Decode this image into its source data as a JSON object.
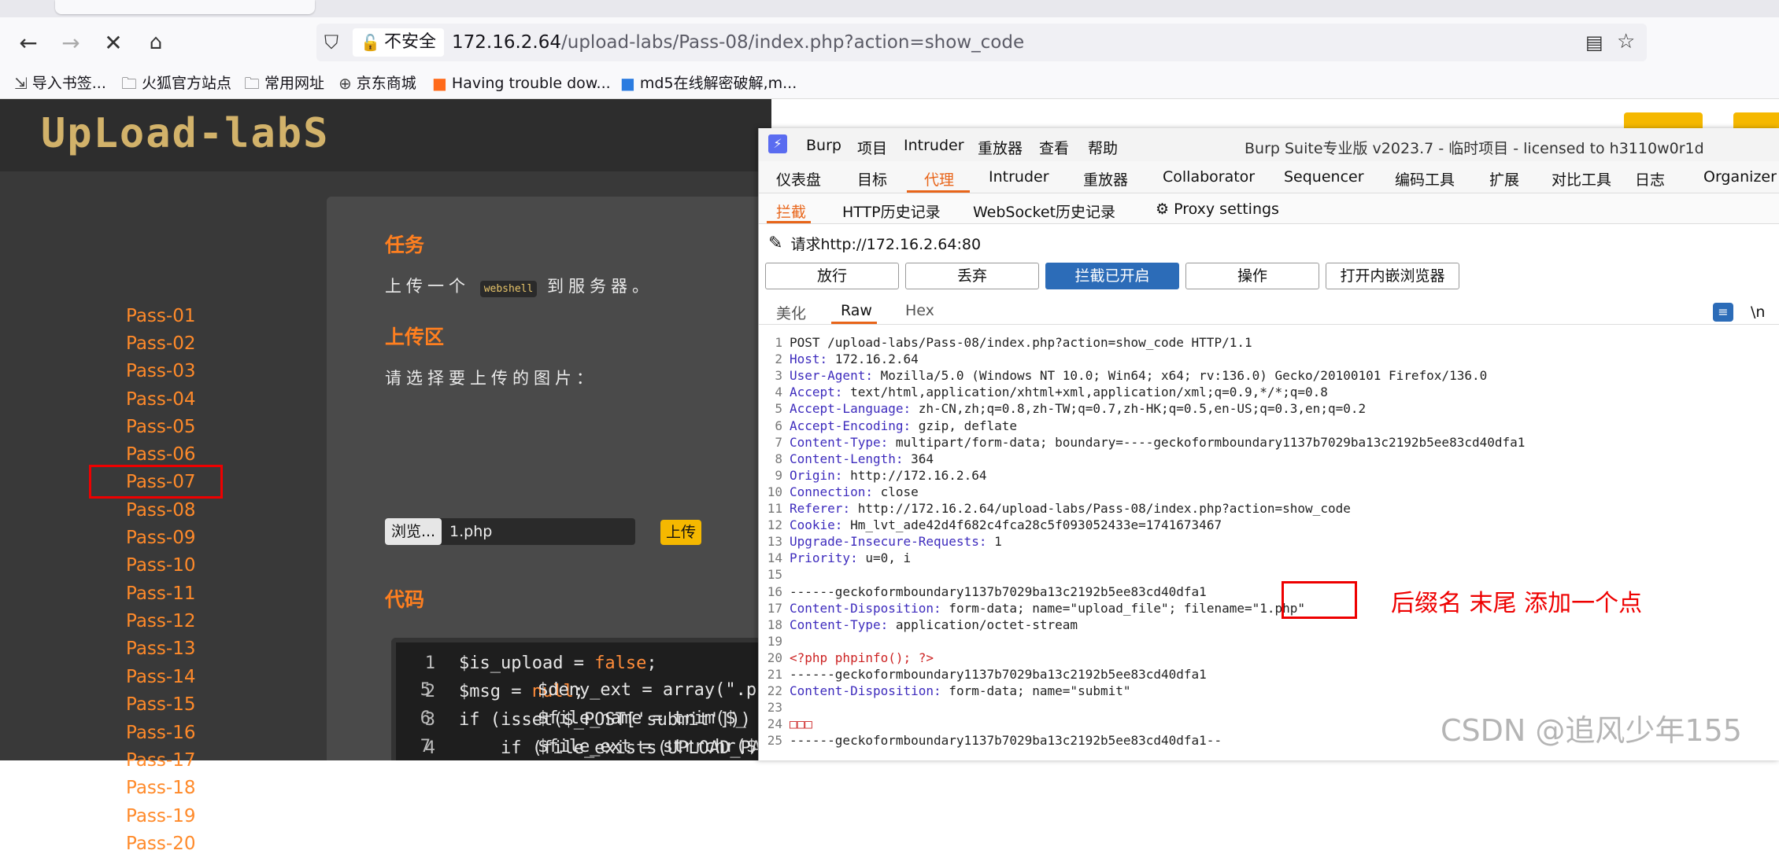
{
  "browser": {
    "insecure_label": "不安全",
    "url_host": "172.16.2.64",
    "url_path": "/upload-labs/Pass-08/index.php?action=show_code",
    "bookmarks": [
      {
        "label": "导入书签...",
        "icon": "import-icon"
      },
      {
        "label": "火狐官方站点",
        "icon": "folder-icon"
      },
      {
        "label": "常用网址",
        "icon": "folder-icon"
      },
      {
        "label": "京东商城",
        "icon": "globe-icon"
      },
      {
        "label": "Having trouble dow...",
        "icon": "bookmark-favicon"
      },
      {
        "label": "md5在线解密破解,m...",
        "icon": "bookmark-favicon"
      }
    ]
  },
  "labs": {
    "logo": "UpLoad-labS",
    "passes": [
      "Pass-01",
      "Pass-02",
      "Pass-03",
      "Pass-04",
      "Pass-05",
      "Pass-06",
      "Pass-07",
      "Pass-08",
      "Pass-09",
      "Pass-10",
      "Pass-11",
      "Pass-12",
      "Pass-13",
      "Pass-14",
      "Pass-15",
      "Pass-16",
      "Pass-17",
      "Pass-18",
      "Pass-19",
      "Pass-20"
    ],
    "task_title": "任务",
    "task_text_pre": "上传一个",
    "task_code": "webshell",
    "task_text_post": "到服务器。",
    "upload_title": "上传区",
    "upload_prompt": "请选择要上传的图片：",
    "browse_label": "浏览...",
    "file_name": "1.php",
    "upload_button": "上传",
    "code_title": "代码",
    "code_lines": [
      {
        "n": "1",
        "text": "$is_upload = false;"
      },
      {
        "n": "2",
        "text": "$msg = null;"
      },
      {
        "n": "3",
        "text": "if (isset($_POST['submit'])) {"
      },
      {
        "n": "4",
        "text": "    if (file_exists(UPLOAD_PA"
      },
      {
        "n": "5",
        "text": "        $deny_ext = array(\".p"
      },
      {
        "n": "6",
        "text": "        $file_name = trim($_"
      },
      {
        "n": "7",
        "text": "        $file_ext = strrchr($"
      }
    ]
  },
  "burp": {
    "menu": [
      "Burp",
      "项目",
      "Intruder",
      "重放器",
      "查看",
      "帮助"
    ],
    "title": "Burp Suite专业版  v2023.7 - 临时项目 - licensed to h3110w0r1d",
    "tabs": [
      "仪表盘",
      "目标",
      "代理",
      "Intruder",
      "重放器",
      "Collaborator",
      "Sequencer",
      "编码工具",
      "扩展",
      "对比工具",
      "日志",
      "Organizer"
    ],
    "subtabs": [
      "拦截",
      "HTTP历史记录",
      "WebSocket历史记录",
      "Proxy settings"
    ],
    "request_label": "请求http://172.16.2.64:80",
    "buttons": [
      "放行",
      "丢弃",
      "拦截已开启",
      "操作",
      "打开内嵌浏览器"
    ],
    "view_tabs": [
      "美化",
      "Raw",
      "Hex"
    ],
    "newline_toggle": "\\n",
    "request_lines": [
      {
        "n": "1",
        "k": "",
        "v": "POST /upload-labs/Pass-08/index.php?action=show_code HTTP/1.1"
      },
      {
        "n": "2",
        "k": "Host",
        "v": " 172.16.2.64"
      },
      {
        "n": "3",
        "k": "User-Agent",
        "v": " Mozilla/5.0 (Windows NT 10.0; Win64; x64; rv:136.0) Gecko/20100101 Firefox/136.0"
      },
      {
        "n": "4",
        "k": "Accept",
        "v": " text/html,application/xhtml+xml,application/xml;q=0.9,*/*;q=0.8"
      },
      {
        "n": "5",
        "k": "Accept-Language",
        "v": " zh-CN,zh;q=0.8,zh-TW;q=0.7,zh-HK;q=0.5,en-US;q=0.3,en;q=0.2"
      },
      {
        "n": "6",
        "k": "Accept-Encoding",
        "v": " gzip, deflate"
      },
      {
        "n": "7",
        "k": "Content-Type",
        "v": " multipart/form-data; boundary=----geckoformboundary1137b7029ba13c2192b5ee83cd40dfa1"
      },
      {
        "n": "8",
        "k": "Content-Length",
        "v": " 364"
      },
      {
        "n": "9",
        "k": "Origin",
        "v": " http://172.16.2.64"
      },
      {
        "n": "10",
        "k": "Connection",
        "v": " close"
      },
      {
        "n": "11",
        "k": "Referer",
        "v": " http://172.16.2.64/upload-labs/Pass-08/index.php?action=show_code"
      },
      {
        "n": "12",
        "k": "Cookie",
        "v": " Hm_lvt_ade42d4f682c4fca28c5f093052433e=1741673467"
      },
      {
        "n": "13",
        "k": "Upgrade-Insecure-Requests",
        "v": " 1"
      },
      {
        "n": "14",
        "k": "Priority",
        "v": " u=0, i"
      },
      {
        "n": "15",
        "k": "",
        "v": ""
      },
      {
        "n": "16",
        "k": "",
        "v": "------geckoformboundary1137b7029ba13c2192b5ee83cd40dfa1"
      },
      {
        "n": "17",
        "k": "Content-Disposition",
        "v": " form-data; name=\"upload_file\"; filename=\"1.php\""
      },
      {
        "n": "18",
        "k": "Content-Type",
        "v": " application/octet-stream"
      },
      {
        "n": "19",
        "k": "",
        "v": ""
      },
      {
        "n": "20",
        "k": "",
        "v": "<?php phpinfo(); ?>"
      },
      {
        "n": "21",
        "k": "",
        "v": "------geckoformboundary1137b7029ba13c2192b5ee83cd40dfa1"
      },
      {
        "n": "22",
        "k": "Content-Disposition",
        "v": " form-data; name=\"submit\""
      },
      {
        "n": "23",
        "k": "",
        "v": ""
      },
      {
        "n": "24",
        "k": "",
        "v": "□□□"
      },
      {
        "n": "25",
        "k": "",
        "v": "------geckoformboundary1137b7029ba13c2192b5ee83cd40dfa1--"
      }
    ]
  },
  "annotation": "后缀名 末尾 添加一个点",
  "watermark": "CSDN @追风少年155"
}
